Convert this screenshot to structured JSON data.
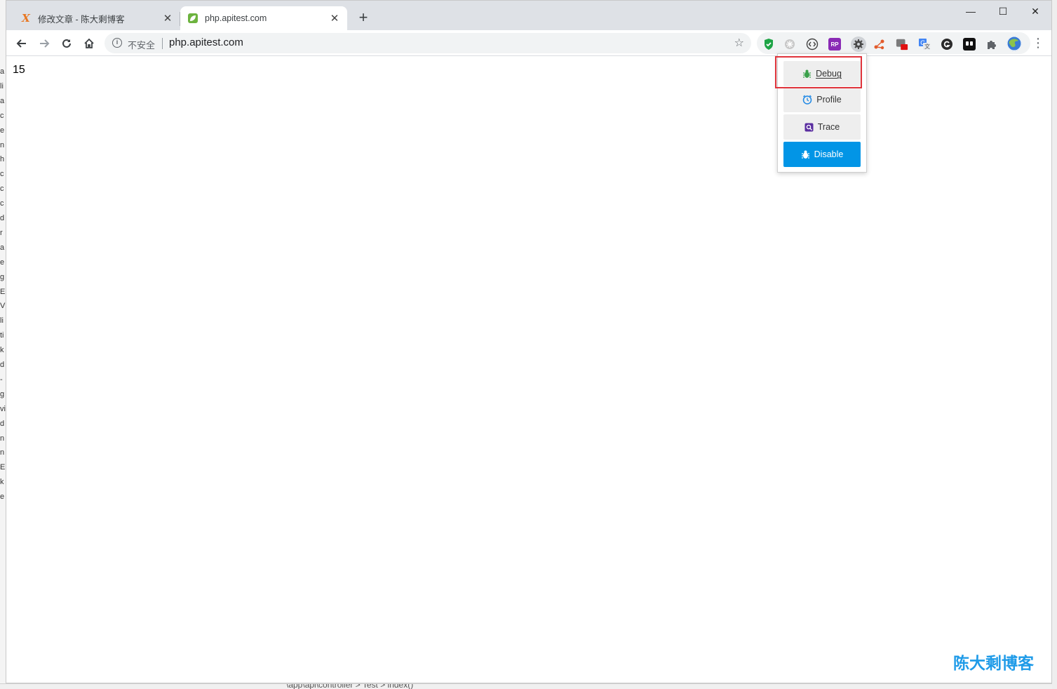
{
  "tabs": [
    {
      "title": "修改文章 - 陈大剩博客",
      "favicon": "x-icon"
    },
    {
      "title": "php.apitest.com",
      "favicon": "leaf-icon"
    }
  ],
  "window_controls": {
    "minimize": "—",
    "maximize": "☐",
    "close": "✕"
  },
  "address_bar": {
    "security_label": "不安全",
    "url": "php.apitest.com"
  },
  "page": {
    "body_text": "15"
  },
  "xdebug_popup": {
    "items": [
      {
        "label": "Debug",
        "icon": "bug-icon",
        "color": "#3aa04a"
      },
      {
        "label": "Profile",
        "icon": "clock-icon",
        "color": "#1e88e5"
      },
      {
        "label": "Trace",
        "icon": "trace-icon",
        "color": "#5a2ea0"
      },
      {
        "label": "Disable",
        "icon": "bug-icon",
        "color": "#ffffff"
      }
    ],
    "highlighted": "Debug"
  },
  "background_window": {
    "side_letters": [
      "a",
      "li",
      "a",
      "c",
      "e",
      "n",
      "h",
      "c",
      "c",
      "c",
      "d",
      "r",
      "a",
      "e",
      "g",
      "E",
      "V",
      "li",
      "ti",
      "k",
      "d",
      "-",
      "g",
      "vi",
      "d",
      "n",
      "n",
      "E",
      "k",
      "e"
    ],
    "bottom_path": "\\app\\api\\controller > Test > index()"
  },
  "watermark": "陈大剩博客"
}
